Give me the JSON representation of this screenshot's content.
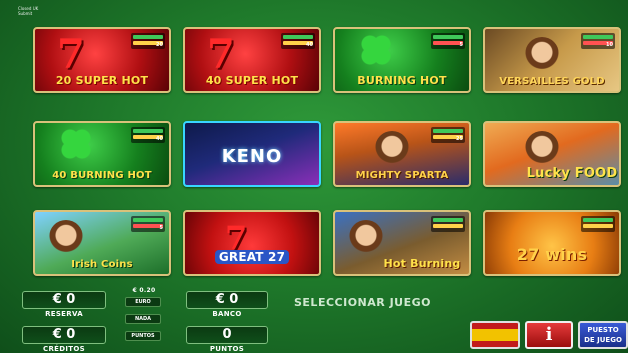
{
  "top_left": {
    "line1": "Closed UK",
    "line2": "Submit"
  },
  "games": [
    {
      "title": "20 SUPER HOT",
      "bet": "20",
      "title_color": "#ffe24a"
    },
    {
      "title": "40 SUPER HOT",
      "bet": "40",
      "title_color": "#ffe24a"
    },
    {
      "title": "BURNING HOT",
      "bet": "5",
      "title_color": "#ffe24a"
    },
    {
      "title": "VERSAILLES GOLD",
      "bet": "10",
      "title_color": "#ffd65a"
    },
    {
      "title": "40 BURNING HOT",
      "bet": "40",
      "title_color": "#ffe24a"
    },
    {
      "title": "KENO",
      "bet": "",
      "title_color": "#ffffff"
    },
    {
      "title": "MIGHTY SPARTA",
      "bet": "25",
      "title_color": "#ffd24a"
    },
    {
      "title": "Lucky FOOD",
      "bet": "",
      "title_color": "#ffe24a"
    },
    {
      "title": "Irish Coins",
      "bet": "5",
      "title_color": "#ffe24a"
    },
    {
      "title": "GREAT 27",
      "bet": "",
      "title_color": "#ffffff"
    },
    {
      "title": "Hot Burning",
      "bet": "",
      "title_color": "#ffe24a"
    },
    {
      "title": "27 wins",
      "bet": "",
      "title_color": "#ffd24a"
    }
  ],
  "panel": {
    "reserva_value": "€ 0",
    "reserva_label": "RESERVA",
    "creditos_value": "€ 0",
    "creditos_label": "CRÉDITOS",
    "denom": "€ 0.20",
    "denom_options": [
      "EURO",
      "NADA",
      "PUNTOS"
    ],
    "banco_value": "€ 0",
    "banco_label": "BANCO",
    "puntos_value": "0",
    "puntos_label": "PUNTOS",
    "seleccionar": "SELECCIONAR JUEGO"
  },
  "buttons": {
    "info": "i",
    "puesto_line1": "PUESTO",
    "puesto_line2": "DE JUEGO"
  },
  "colors": {
    "background": "#1f7a2b",
    "frame": "#d9c27a"
  }
}
